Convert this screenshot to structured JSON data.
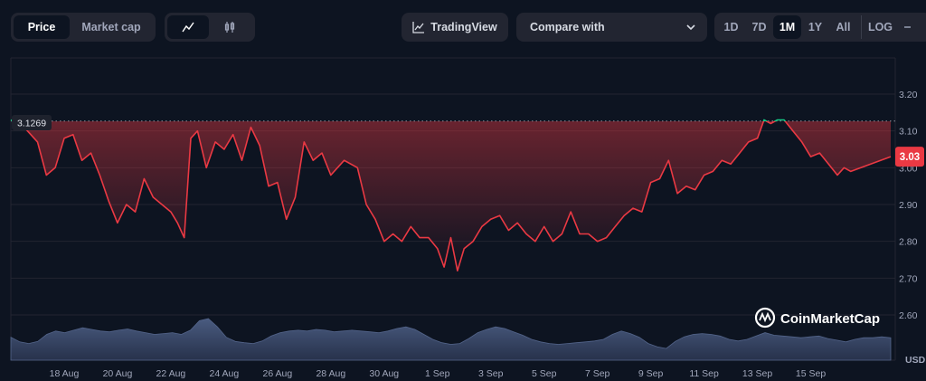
{
  "toolbar": {
    "type_tabs": [
      {
        "label": "Price",
        "active": true
      },
      {
        "label": "Market cap",
        "active": false
      }
    ],
    "style_tabs": [
      {
        "icon": "line-chart-icon",
        "active": true
      },
      {
        "icon": "candlestick-icon",
        "active": false
      }
    ],
    "tradingview_label": "TradingView",
    "compare_label": "Compare with",
    "ranges": [
      {
        "label": "1D"
      },
      {
        "label": "7D"
      },
      {
        "label": "1M",
        "active": true
      },
      {
        "label": "1Y"
      },
      {
        "label": "All"
      }
    ],
    "log_label": "LOG"
  },
  "watermark": "CoinMarketCap",
  "colors": {
    "background": "#0d1421",
    "down": "#ea3943",
    "up": "#16c784",
    "volume": "#3a4a6b",
    "panel": "#222531"
  },
  "chart_data": {
    "type": "line",
    "ylim": [
      2.55,
      3.32
    ],
    "yticks": [
      "3.20",
      "3.10",
      "3.00",
      "2.90",
      "2.80",
      "2.70",
      "2.60"
    ],
    "xticks": [
      "18 Aug",
      "20 Aug",
      "22 Aug",
      "24 Aug",
      "26 Aug",
      "28 Aug",
      "30 Aug",
      "1 Sep",
      "3 Sep",
      "5 Sep",
      "7 Sep",
      "9 Sep",
      "11 Sep",
      "13 Sep",
      "15 Sep"
    ],
    "x_start": "16 Aug",
    "x_end": "17 Sep",
    "reference_value": "3.1269",
    "current_value": "3.03",
    "currency": "USD",
    "grid": true,
    "price": [
      [
        "16 Aug",
        3.13
      ],
      [
        "16 Aug",
        3.11
      ],
      [
        "17 Aug",
        3.07
      ],
      [
        "17 Aug",
        2.98
      ],
      [
        "17 Aug",
        3.0
      ],
      [
        "18 Aug",
        3.08
      ],
      [
        "18 Aug",
        3.09
      ],
      [
        "18 Aug",
        3.02
      ],
      [
        "19 Aug",
        3.04
      ],
      [
        "19 Aug",
        2.98
      ],
      [
        "19 Aug",
        2.91
      ],
      [
        "20 Aug",
        2.85
      ],
      [
        "20 Aug",
        2.9
      ],
      [
        "20 Aug",
        2.88
      ],
      [
        "21 Aug",
        2.97
      ],
      [
        "21 Aug",
        2.92
      ],
      [
        "21 Aug",
        2.9
      ],
      [
        "22 Aug",
        2.88
      ],
      [
        "22 Aug",
        2.85
      ],
      [
        "22 Aug",
        2.81
      ],
      [
        "22 Aug",
        3.08
      ],
      [
        "23 Aug",
        3.1
      ],
      [
        "23 Aug",
        3.0
      ],
      [
        "23 Aug",
        3.07
      ],
      [
        "24 Aug",
        3.05
      ],
      [
        "24 Aug",
        3.09
      ],
      [
        "24 Aug",
        3.02
      ],
      [
        "25 Aug",
        3.11
      ],
      [
        "25 Aug",
        3.06
      ],
      [
        "25 Aug",
        2.95
      ],
      [
        "26 Aug",
        2.96
      ],
      [
        "26 Aug",
        2.86
      ],
      [
        "26 Aug",
        2.92
      ],
      [
        "27 Aug",
        3.07
      ],
      [
        "27 Aug",
        3.02
      ],
      [
        "27 Aug",
        3.04
      ],
      [
        "28 Aug",
        2.98
      ],
      [
        "28 Aug",
        3.02
      ],
      [
        "29 Aug",
        3.0
      ],
      [
        "29 Aug",
        2.9
      ],
      [
        "29 Aug",
        2.86
      ],
      [
        "30 Aug",
        2.8
      ],
      [
        "30 Aug",
        2.82
      ],
      [
        "30 Aug",
        2.8
      ],
      [
        "31 Aug",
        2.84
      ],
      [
        "31 Aug",
        2.81
      ],
      [
        "31 Aug",
        2.81
      ],
      [
        "1 Sep",
        2.78
      ],
      [
        "1 Sep",
        2.73
      ],
      [
        "1 Sep",
        2.81
      ],
      [
        "1 Sep",
        2.72
      ],
      [
        "2 Sep",
        2.78
      ],
      [
        "2 Sep",
        2.8
      ],
      [
        "2 Sep",
        2.84
      ],
      [
        "3 Sep",
        2.86
      ],
      [
        "3 Sep",
        2.87
      ],
      [
        "3 Sep",
        2.83
      ],
      [
        "4 Sep",
        2.85
      ],
      [
        "4 Sep",
        2.82
      ],
      [
        "4 Sep",
        2.8
      ],
      [
        "5 Sep",
        2.84
      ],
      [
        "5 Sep",
        2.8
      ],
      [
        "5 Sep",
        2.82
      ],
      [
        "6 Sep",
        2.88
      ],
      [
        "6 Sep",
        2.82
      ],
      [
        "6 Sep",
        2.82
      ],
      [
        "7 Sep",
        2.8
      ],
      [
        "7 Sep",
        2.81
      ],
      [
        "7 Sep",
        2.84
      ],
      [
        "8 Sep",
        2.87
      ],
      [
        "8 Sep",
        2.89
      ],
      [
        "8 Sep",
        2.88
      ],
      [
        "9 Sep",
        2.96
      ],
      [
        "9 Sep",
        2.97
      ],
      [
        "9 Sep",
        3.02
      ],
      [
        "10 Sep",
        2.93
      ],
      [
        "10 Sep",
        2.95
      ],
      [
        "10 Sep",
        2.94
      ],
      [
        "11 Sep",
        2.98
      ],
      [
        "11 Sep",
        2.99
      ],
      [
        "11 Sep",
        3.02
      ],
      [
        "12 Sep",
        3.01
      ],
      [
        "12 Sep",
        3.04
      ],
      [
        "12 Sep",
        3.07
      ],
      [
        "13 Sep",
        3.08
      ],
      [
        "13 Sep",
        3.13
      ],
      [
        "13 Sep",
        3.12
      ],
      [
        "13 Sep",
        3.13
      ],
      [
        "14 Sep",
        3.13
      ],
      [
        "14 Sep",
        3.1
      ],
      [
        "14 Sep",
        3.07
      ],
      [
        "15 Sep",
        3.03
      ],
      [
        "15 Sep",
        3.04
      ],
      [
        "15 Sep",
        3.01
      ],
      [
        "16 Sep",
        2.98
      ],
      [
        "16 Sep",
        3.0
      ],
      [
        "16 Sep",
        2.99
      ],
      [
        "16 Sep",
        3.03
      ]
    ],
    "volume_level": [
      0.55,
      0.44,
      0.4,
      0.45,
      0.62,
      0.7,
      0.66,
      0.72,
      0.78,
      0.74,
      0.7,
      0.68,
      0.72,
      0.75,
      0.7,
      0.66,
      0.62,
      0.64,
      0.66,
      0.62,
      0.72,
      0.95,
      1.0,
      0.8,
      0.55,
      0.45,
      0.42,
      0.4,
      0.46,
      0.58,
      0.66,
      0.7,
      0.72,
      0.7,
      0.74,
      0.72,
      0.68,
      0.7,
      0.72,
      0.7,
      0.68,
      0.66,
      0.7,
      0.76,
      0.8,
      0.74,
      0.62,
      0.5,
      0.42,
      0.38,
      0.4,
      0.52,
      0.66,
      0.74,
      0.8,
      0.76,
      0.68,
      0.6,
      0.5,
      0.44,
      0.4,
      0.38,
      0.4,
      0.42,
      0.44,
      0.46,
      0.5,
      0.62,
      0.7,
      0.64,
      0.55,
      0.4,
      0.32,
      0.28,
      0.45,
      0.56,
      0.62,
      0.64,
      0.62,
      0.58,
      0.5,
      0.46,
      0.5,
      0.58,
      0.66,
      0.6,
      0.58,
      0.56,
      0.54,
      0.56,
      0.58,
      0.52,
      0.48,
      0.44,
      0.5,
      0.54,
      0.54,
      0.56,
      0.54
    ]
  }
}
